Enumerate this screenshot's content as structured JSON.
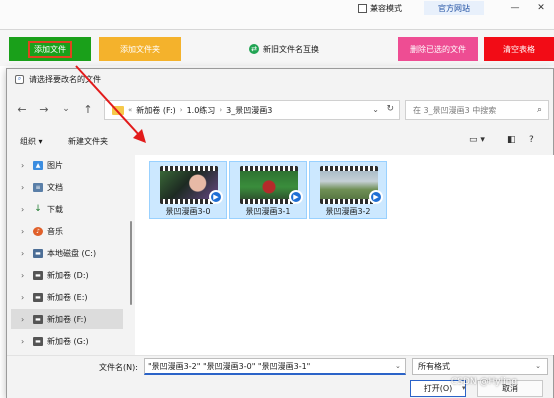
{
  "app": {
    "compat_mode_label": "兼容模式",
    "official_site": "官方网站",
    "win_minimize": "—",
    "win_close": "✕",
    "toolbar": {
      "add_file": "添加文件",
      "add_folder": "添加文件夹",
      "new_old_interchange": "新旧文件名互换",
      "delete_selected": "删除已选的文件",
      "clear_table": "清空表格"
    },
    "colors": {
      "add_file": "#1aa01a",
      "add_folder": "#f4b22c",
      "delete": "#ee4d93",
      "clear": "#f20c16"
    }
  },
  "dialog": {
    "title": "请选择要改名的文件",
    "nav": {
      "back": "←",
      "forward": "→",
      "down": "⌄",
      "up": "↑"
    },
    "address": {
      "prefix": "«",
      "segments": [
        "新加卷 (F:)",
        "1.0练习",
        "3_景凹漫画3"
      ],
      "separator": "›"
    },
    "search_placeholder": "在 3_景凹漫画3 中搜索",
    "command_bar": {
      "organize": "组织 ▾",
      "new_folder": "新建文件夹"
    },
    "nav_pane": [
      {
        "label": "图片",
        "icon": "pictures-icon"
      },
      {
        "label": "文档",
        "icon": "documents-icon"
      },
      {
        "label": "下载",
        "icon": "downloads-icon"
      },
      {
        "label": "音乐",
        "icon": "music-icon"
      },
      {
        "label": "本地磁盘 (C:)",
        "icon": "drive-icon"
      },
      {
        "label": "新加卷 (D:)",
        "icon": "drive-icon"
      },
      {
        "label": "新加卷 (E:)",
        "icon": "drive-icon"
      },
      {
        "label": "新加卷 (F:)",
        "icon": "drive-icon",
        "selected": true
      },
      {
        "label": "新加卷 (G:)",
        "icon": "drive-icon"
      }
    ],
    "files": [
      {
        "name": "景凹漫画3-0"
      },
      {
        "name": "景凹漫画3-1"
      },
      {
        "name": "景凹漫画3-2"
      }
    ],
    "footer": {
      "filename_label": "文件名(N):",
      "filename_value": "\"景凹漫画3-2\" \"景凹漫画3-0\" \"景凹漫画3-1\"",
      "filter_value": "所有格式",
      "open": "打开(O)",
      "cancel": "取消"
    }
  },
  "watermark": "CSDN @Hyling"
}
